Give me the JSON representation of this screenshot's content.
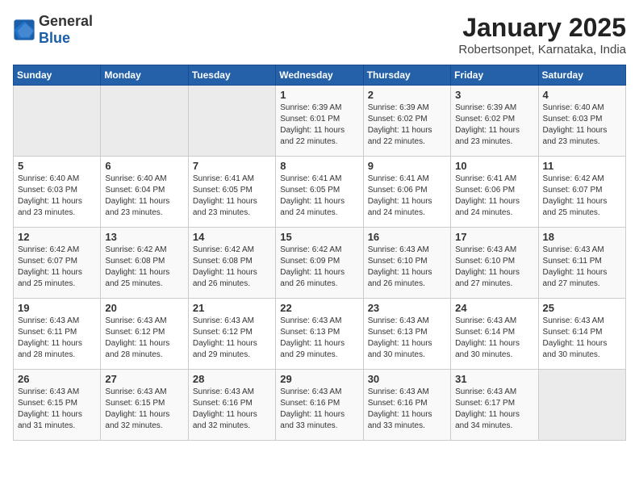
{
  "logo": {
    "general": "General",
    "blue": "Blue"
  },
  "title": "January 2025",
  "location": "Robertsonpet, Karnataka, India",
  "weekdays": [
    "Sunday",
    "Monday",
    "Tuesday",
    "Wednesday",
    "Thursday",
    "Friday",
    "Saturday"
  ],
  "weeks": [
    [
      {
        "day": "",
        "info": ""
      },
      {
        "day": "",
        "info": ""
      },
      {
        "day": "",
        "info": ""
      },
      {
        "day": "1",
        "info": "Sunrise: 6:39 AM\nSunset: 6:01 PM\nDaylight: 11 hours\nand 22 minutes."
      },
      {
        "day": "2",
        "info": "Sunrise: 6:39 AM\nSunset: 6:02 PM\nDaylight: 11 hours\nand 22 minutes."
      },
      {
        "day": "3",
        "info": "Sunrise: 6:39 AM\nSunset: 6:02 PM\nDaylight: 11 hours\nand 23 minutes."
      },
      {
        "day": "4",
        "info": "Sunrise: 6:40 AM\nSunset: 6:03 PM\nDaylight: 11 hours\nand 23 minutes."
      }
    ],
    [
      {
        "day": "5",
        "info": "Sunrise: 6:40 AM\nSunset: 6:03 PM\nDaylight: 11 hours\nand 23 minutes."
      },
      {
        "day": "6",
        "info": "Sunrise: 6:40 AM\nSunset: 6:04 PM\nDaylight: 11 hours\nand 23 minutes."
      },
      {
        "day": "7",
        "info": "Sunrise: 6:41 AM\nSunset: 6:05 PM\nDaylight: 11 hours\nand 23 minutes."
      },
      {
        "day": "8",
        "info": "Sunrise: 6:41 AM\nSunset: 6:05 PM\nDaylight: 11 hours\nand 24 minutes."
      },
      {
        "day": "9",
        "info": "Sunrise: 6:41 AM\nSunset: 6:06 PM\nDaylight: 11 hours\nand 24 minutes."
      },
      {
        "day": "10",
        "info": "Sunrise: 6:41 AM\nSunset: 6:06 PM\nDaylight: 11 hours\nand 24 minutes."
      },
      {
        "day": "11",
        "info": "Sunrise: 6:42 AM\nSunset: 6:07 PM\nDaylight: 11 hours\nand 25 minutes."
      }
    ],
    [
      {
        "day": "12",
        "info": "Sunrise: 6:42 AM\nSunset: 6:07 PM\nDaylight: 11 hours\nand 25 minutes."
      },
      {
        "day": "13",
        "info": "Sunrise: 6:42 AM\nSunset: 6:08 PM\nDaylight: 11 hours\nand 25 minutes."
      },
      {
        "day": "14",
        "info": "Sunrise: 6:42 AM\nSunset: 6:08 PM\nDaylight: 11 hours\nand 26 minutes."
      },
      {
        "day": "15",
        "info": "Sunrise: 6:42 AM\nSunset: 6:09 PM\nDaylight: 11 hours\nand 26 minutes."
      },
      {
        "day": "16",
        "info": "Sunrise: 6:43 AM\nSunset: 6:10 PM\nDaylight: 11 hours\nand 26 minutes."
      },
      {
        "day": "17",
        "info": "Sunrise: 6:43 AM\nSunset: 6:10 PM\nDaylight: 11 hours\nand 27 minutes."
      },
      {
        "day": "18",
        "info": "Sunrise: 6:43 AM\nSunset: 6:11 PM\nDaylight: 11 hours\nand 27 minutes."
      }
    ],
    [
      {
        "day": "19",
        "info": "Sunrise: 6:43 AM\nSunset: 6:11 PM\nDaylight: 11 hours\nand 28 minutes."
      },
      {
        "day": "20",
        "info": "Sunrise: 6:43 AM\nSunset: 6:12 PM\nDaylight: 11 hours\nand 28 minutes."
      },
      {
        "day": "21",
        "info": "Sunrise: 6:43 AM\nSunset: 6:12 PM\nDaylight: 11 hours\nand 29 minutes."
      },
      {
        "day": "22",
        "info": "Sunrise: 6:43 AM\nSunset: 6:13 PM\nDaylight: 11 hours\nand 29 minutes."
      },
      {
        "day": "23",
        "info": "Sunrise: 6:43 AM\nSunset: 6:13 PM\nDaylight: 11 hours\nand 30 minutes."
      },
      {
        "day": "24",
        "info": "Sunrise: 6:43 AM\nSunset: 6:14 PM\nDaylight: 11 hours\nand 30 minutes."
      },
      {
        "day": "25",
        "info": "Sunrise: 6:43 AM\nSunset: 6:14 PM\nDaylight: 11 hours\nand 30 minutes."
      }
    ],
    [
      {
        "day": "26",
        "info": "Sunrise: 6:43 AM\nSunset: 6:15 PM\nDaylight: 11 hours\nand 31 minutes."
      },
      {
        "day": "27",
        "info": "Sunrise: 6:43 AM\nSunset: 6:15 PM\nDaylight: 11 hours\nand 32 minutes."
      },
      {
        "day": "28",
        "info": "Sunrise: 6:43 AM\nSunset: 6:16 PM\nDaylight: 11 hours\nand 32 minutes."
      },
      {
        "day": "29",
        "info": "Sunrise: 6:43 AM\nSunset: 6:16 PM\nDaylight: 11 hours\nand 33 minutes."
      },
      {
        "day": "30",
        "info": "Sunrise: 6:43 AM\nSunset: 6:16 PM\nDaylight: 11 hours\nand 33 minutes."
      },
      {
        "day": "31",
        "info": "Sunrise: 6:43 AM\nSunset: 6:17 PM\nDaylight: 11 hours\nand 34 minutes."
      },
      {
        "day": "",
        "info": ""
      }
    ]
  ]
}
